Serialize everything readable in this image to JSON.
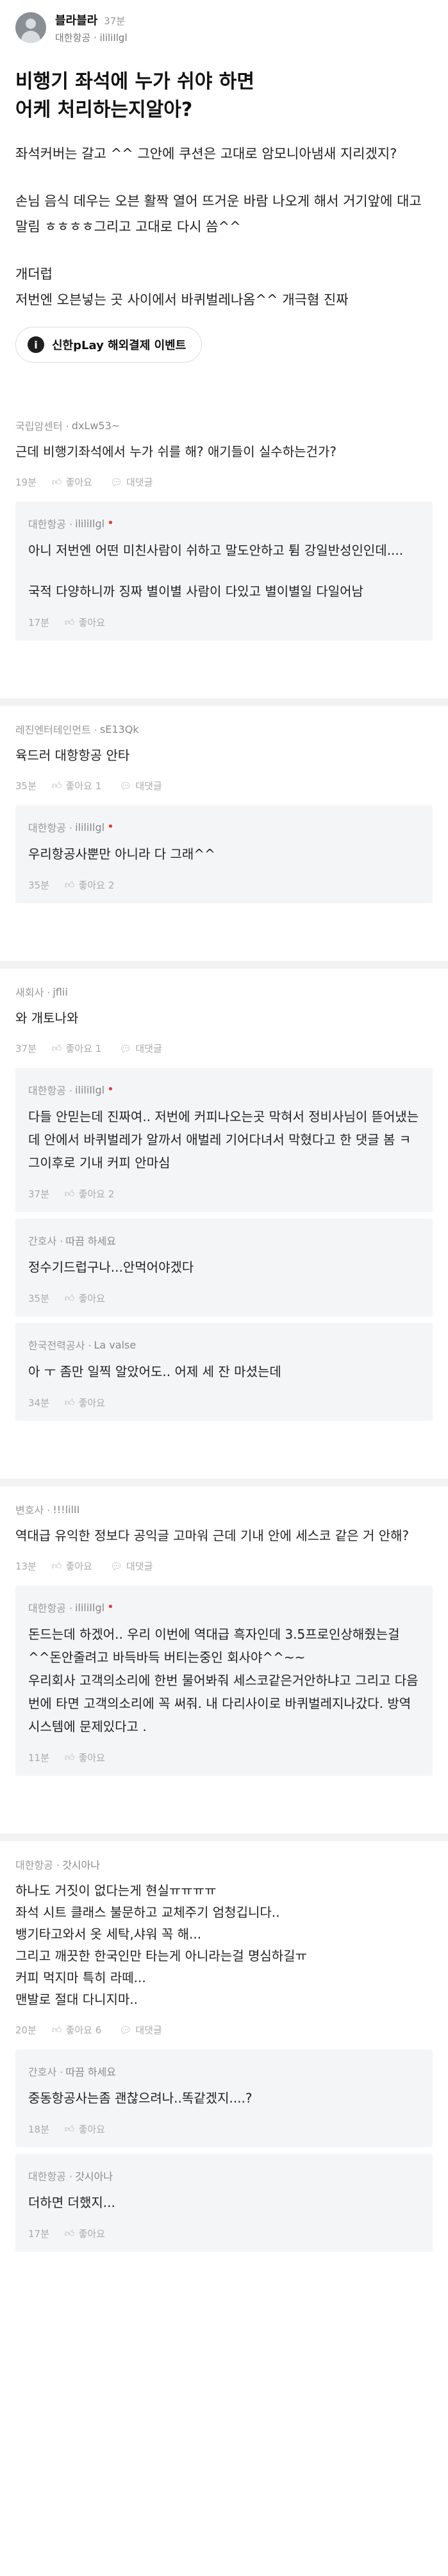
{
  "post": {
    "author": "블라블라",
    "time": "37분",
    "company": "대한항공 · ililiIlgl",
    "title_line1": "비행기 좌석에 누가 쉬야 하면",
    "title_line2": "어케 처리하는지알아?",
    "body1": "좌석커버는 갈고 ^^ 그안에 쿠션은 고대로 암모니아냄새 지리겠지?",
    "body2": "손님 음식 데우는 오븐 활짝 열어 뜨거운 바람 나오게 해서 거기앞에 대고 말림 ㅎㅎㅎㅎ그리고 고대로 다시 씀^^",
    "body3a": "개더럽",
    "body3b": "저번엔 오븐넣는 곳 사이에서 바퀴벌레나옴^^ 개극혐 진짜",
    "promo_label": "신한pLay 해외결제 이벤트"
  },
  "labels": {
    "like": "좋아요",
    "reply": "대댓글"
  },
  "threads": [
    {
      "comment": {
        "company": "국립암센터 ·",
        "nick": "dxLw53~",
        "text": "근데 비행기좌석에서 누가 쉬를 해? 애기들이 실수하는건가?",
        "time": "19분",
        "likes": "좋아요"
      },
      "replies": [
        {
          "company": "대한항공 ·",
          "nick": "ililiIlgl",
          "text": "아니 저번엔 어떤 미친사람이 쉬하고 말도안하고 튐 강일반성인인데....\n\n국적 다양하니까 징짜 별이별 사람이 다있고 별이별일 다일어남",
          "time": "17분",
          "likes": "좋아요"
        }
      ]
    },
    {
      "comment": {
        "company": "레진엔터테인먼트 ·",
        "nick": "sE13Qk",
        "text": "육드러 대항항공 안타",
        "time": "35분",
        "likes": "좋아요 1"
      },
      "replies": [
        {
          "company": "대한항공 ·",
          "nick": "ililiIlgl",
          "text": "우리항공사뿐만 아니라 다 그래^^",
          "time": "35분",
          "likes": "좋아요 2"
        }
      ]
    },
    {
      "comment": {
        "company": "새회사 ·",
        "nick": "jflii",
        "text": "와 개토나와",
        "time": "37분",
        "likes": "좋아요 1"
      },
      "replies": [
        {
          "company": "대한항공 ·",
          "nick": "ililiIlgl",
          "text": "다들 안믿는데 진짜여.. 저번에 커피나오는곳 막혀서 정비사님이 뜯어냈는데 안에서 바퀴벌레가 알까서 애벌레 기어다녀서 막혔다고 한 댓글 봄 ㅋ\n그이후로 기내 커피 안마심",
          "time": "37분",
          "likes": "좋아요 2"
        },
        {
          "company": "간호사 ·",
          "nick": "따끔 하세요",
          "text": "정수기드럽구나...안먹어야겠다",
          "time": "35분",
          "likes": "좋아요"
        },
        {
          "company": "한국전력공사 ·",
          "nick": "La valse",
          "text": "아 ㅜ 좀만 일찍 알았어도.. 어제 세 잔 마셨는데",
          "time": "34분",
          "likes": "좋아요"
        }
      ]
    },
    {
      "comment": {
        "company": "변호사 ·",
        "nick": "!!!lilII",
        "text": "역대급 유익한 정보다 공익글 고마워 근데 기내 안에 세스코 같은 거 안해?",
        "time": "13분",
        "likes": "좋아요"
      },
      "replies": [
        {
          "company": "대한항공 ·",
          "nick": "ililiIlgl",
          "text": "돈드는데 하겠어.. 우리 이번에 역대급 흑자인데 3.5프로인상해줬는걸^^돈안줄려고 바득바득 버티는중인 회사야^^~~\n우리회사 고객의소리에 한번 물어봐줘 세스코같은거안하냐고 그리고 다음번에 타면 고객의소리에 꼭 써줘. 내 다리사이로 바퀴벌레지나갔다. 방역시스템에 문제있다고 .",
          "time": "11분",
          "likes": "좋아요"
        }
      ]
    },
    {
      "comment": {
        "company": "대한항공 ·",
        "nick": "갓시아나",
        "text": "하나도 거짓이 없다는게 현실ㅠㅠㅠㅠ\n좌석 시트 클래스 불문하고 교체주기 엄청깁니다..\n뱅기타고와서 옷 세탁,샤워 꼭 해...\n그리고 깨끗한 한국인만 타는게 아니라는걸 명심하길ㅠ\n커피 먹지마 특히 라떼...\n맨발로 절대 다니지마..",
        "time": "20분",
        "likes": "좋아요 6"
      },
      "replies": [
        {
          "company": "간호사 ·",
          "nick": "따끔 하세요",
          "text": "중동항공사는좀 괜찮으려나..똑같겠지....?",
          "time": "18분",
          "likes": "좋아요"
        },
        {
          "company": "대한항공 ·",
          "nick": "갓시아나",
          "text": "더하면 더했지...",
          "time": "17분",
          "likes": "좋아요"
        }
      ]
    }
  ]
}
